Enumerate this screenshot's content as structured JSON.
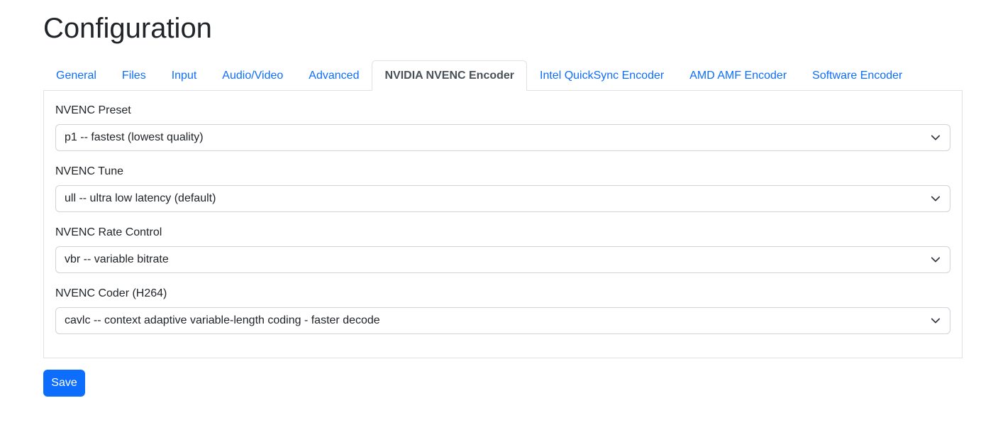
{
  "page": {
    "title": "Configuration"
  },
  "tabs": [
    {
      "label": "General",
      "active": false
    },
    {
      "label": "Files",
      "active": false
    },
    {
      "label": "Input",
      "active": false
    },
    {
      "label": "Audio/Video",
      "active": false
    },
    {
      "label": "Advanced",
      "active": false
    },
    {
      "label": "NVIDIA NVENC Encoder",
      "active": true
    },
    {
      "label": "Intel QuickSync Encoder",
      "active": false
    },
    {
      "label": "AMD AMF Encoder",
      "active": false
    },
    {
      "label": "Software Encoder",
      "active": false
    }
  ],
  "fields": [
    {
      "label": "NVENC Preset",
      "value": "p1 -- fastest (lowest quality)"
    },
    {
      "label": "NVENC Tune",
      "value": "ull -- ultra low latency (default)"
    },
    {
      "label": "NVENC Rate Control",
      "value": "vbr -- variable bitrate"
    },
    {
      "label": "NVENC Coder (H264)",
      "value": "cavlc -- context adaptive variable-length coding - faster decode"
    }
  ],
  "actions": {
    "save_label": "Save"
  },
  "colors": {
    "accent": "#0d6efd",
    "text": "#212529",
    "active_tab_text": "#495057",
    "border": "#dee2e6"
  },
  "icons": {
    "select_chevron": "chevron-down-icon"
  }
}
